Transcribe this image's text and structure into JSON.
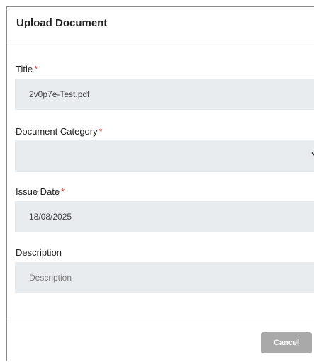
{
  "dialog": {
    "title": "Upload Document",
    "close_label": "×"
  },
  "form": {
    "title_field": {
      "label": "Title",
      "required_mark": "*",
      "value": "2v0p7e-Test.pdf"
    },
    "category_field": {
      "label": "Document Category",
      "required_mark": "*",
      "value": ""
    },
    "issue_date_field": {
      "label": "Issue Date",
      "required_mark": "*",
      "value": "18/08/2025"
    },
    "description_field": {
      "label": "Description",
      "value": "",
      "placeholder": "Description"
    }
  },
  "footer": {
    "cancel_label": "Cancel"
  },
  "icons": {
    "close": "close-icon",
    "dropdown": "chevron-down-icon"
  },
  "colors": {
    "required": "#e0443e",
    "field_background": "#e9ecef",
    "cancel_button": "#a9a9a9"
  }
}
